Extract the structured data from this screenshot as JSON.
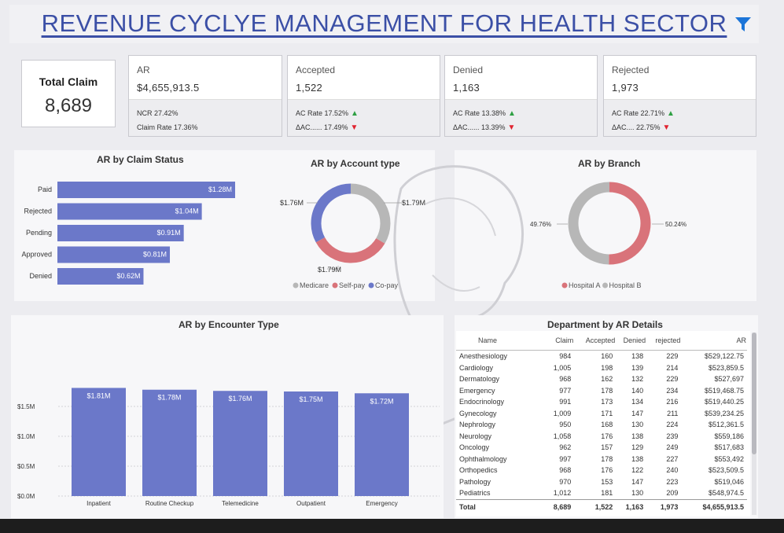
{
  "title": "REVENUE CYCLYE MANAGEMENT FOR HEALTH SECTOR",
  "colors": {
    "accent": "#3b4fa6",
    "bar": "#6b78c9",
    "pink": "#d9737a",
    "grey": "#b7b7b7",
    "up": "#2ea043",
    "down": "#e0232f"
  },
  "filter_icon": "funnel-icon",
  "kpis": {
    "total_claim": {
      "label": "Total Claim",
      "value": "8,689"
    },
    "ar": {
      "label": "AR",
      "value": "$4,655,913.5",
      "line1": "NCR 27.42%",
      "line2": "Claim Rate 17.36%"
    },
    "accepted": {
      "label": "Accepted",
      "value": "1,522",
      "line1": "AC Rate 17.52%",
      "line2": "ΔAC...... 17.49%"
    },
    "denied": {
      "label": "Denied",
      "value": "1,163",
      "line1": "AC Rate 13.38%",
      "line2": "ΔAC...... 13.39%"
    },
    "rejected": {
      "label": "Rejected",
      "value": "1,973",
      "line1": "AC Rate 22.71%",
      "line2": "ΔAC.... 22.75%"
    }
  },
  "chart_data": [
    {
      "id": "claim_status",
      "type": "bar",
      "orientation": "horizontal",
      "title": "AR by Claim Status",
      "categories": [
        "Paid",
        "Rejected",
        "Pending",
        "Approved",
        "Denied"
      ],
      "values": [
        1.28,
        1.04,
        0.91,
        0.81,
        0.62
      ],
      "labels": [
        "$1.28M",
        "$1.04M",
        "$0.91M",
        "$0.81M",
        "$0.62M"
      ]
    },
    {
      "id": "account_type",
      "type": "pie",
      "donut": true,
      "title": "AR by Account type",
      "categories": [
        "Medicare",
        "Self-pay",
        "Co-pay"
      ],
      "values": [
        1.79,
        1.79,
        1.76
      ],
      "labels": [
        "$1.79M",
        "$1.79M",
        "$1.76M"
      ],
      "colors": [
        "#b7b7b7",
        "#d9737a",
        "#6b78c9"
      ],
      "legend": "bottom"
    },
    {
      "id": "branch",
      "type": "pie",
      "donut": true,
      "title": "AR by Branch",
      "categories": [
        "Hospital A",
        "Hospital B"
      ],
      "values": [
        50.24,
        49.76
      ],
      "labels": [
        "50.24%",
        "49.76%"
      ],
      "colors": [
        "#d9737a",
        "#b7b7b7"
      ],
      "legend": "bottom"
    },
    {
      "id": "encounter_type",
      "type": "bar",
      "title": "AR by Encounter Type",
      "categories": [
        "Inpatient",
        "Routine Checkup",
        "Telemedicine",
        "Outpatient",
        "Emergency"
      ],
      "values": [
        1.81,
        1.78,
        1.76,
        1.75,
        1.72
      ],
      "labels": [
        "$1.81M",
        "$1.78M",
        "$1.76M",
        "$1.75M",
        "$1.72M"
      ],
      "yticks": [
        "$0.0M",
        "$0.5M",
        "$1.0M",
        "$1.5M"
      ],
      "ylim": [
        0,
        2.0
      ],
      "grid": true
    }
  ],
  "dept_table": {
    "title": "Department by AR Details",
    "columns": [
      "Name",
      "Claim",
      "Accepted",
      "Denied",
      "rejected",
      "AR"
    ],
    "rows": [
      [
        "Anesthesiology",
        "984",
        "160",
        "138",
        "229",
        "$529,122.75"
      ],
      [
        "Cardiology",
        "1,005",
        "198",
        "139",
        "214",
        "$523,859.5"
      ],
      [
        "Dermatology",
        "968",
        "162",
        "132",
        "229",
        "$527,697"
      ],
      [
        "Emergency",
        "977",
        "178",
        "140",
        "234",
        "$519,468.75"
      ],
      [
        "Endocrinology",
        "991",
        "173",
        "134",
        "216",
        "$519,440.25"
      ],
      [
        "Gynecology",
        "1,009",
        "171",
        "147",
        "211",
        "$539,234.25"
      ],
      [
        "Nephrology",
        "950",
        "168",
        "130",
        "224",
        "$512,361.5"
      ],
      [
        "Neurology",
        "1,058",
        "176",
        "138",
        "239",
        "$559,186"
      ],
      [
        "Oncology",
        "962",
        "157",
        "129",
        "249",
        "$517,683"
      ],
      [
        "Ophthalmology",
        "997",
        "178",
        "138",
        "227",
        "$553,492"
      ],
      [
        "Orthopedics",
        "968",
        "176",
        "122",
        "240",
        "$523,509.5"
      ],
      [
        "Pathology",
        "970",
        "153",
        "147",
        "223",
        "$519,046"
      ],
      [
        "Pediatrics",
        "1,012",
        "181",
        "130",
        "209",
        "$548,974.5"
      ]
    ],
    "total": [
      "Total",
      "8,689",
      "1,522",
      "1,163",
      "1,973",
      "$4,655,913.5"
    ]
  }
}
